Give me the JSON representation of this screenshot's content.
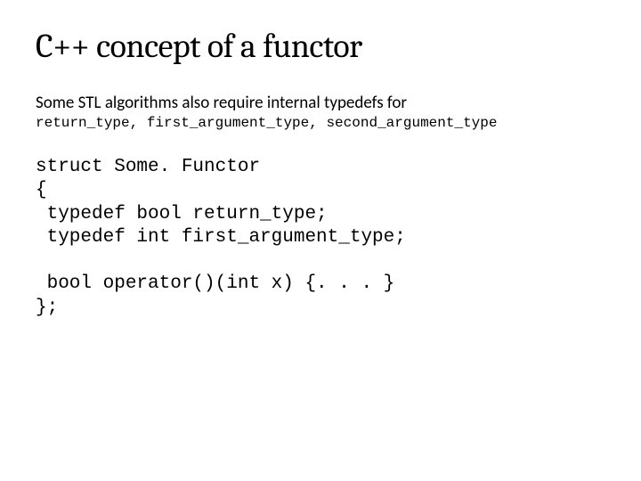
{
  "title": "C++ concept of a functor",
  "intro": "Some STL algorithms also require internal typedefs for",
  "typedef_line": "return_type, first_argument_type, second_argument_type",
  "code": "struct Some. Functor\n{\n typedef bool return_type;\n typedef int first_argument_type;\n\n bool operator()(int x) {. . . }\n};"
}
